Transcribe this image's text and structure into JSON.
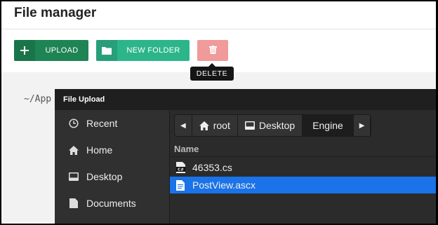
{
  "page": {
    "title": "File manager"
  },
  "toolbar": {
    "upload_label": "UPLOAD",
    "new_folder_label": "NEW FOLDER",
    "delete_tooltip": "DELETE"
  },
  "path": {
    "text": "~/App"
  },
  "dialog": {
    "title": "File Upload",
    "sidebar": [
      {
        "label": "Recent",
        "icon": "clock-icon"
      },
      {
        "label": "Home",
        "icon": "home-icon"
      },
      {
        "label": "Desktop",
        "icon": "desktop-icon"
      },
      {
        "label": "Documents",
        "icon": "document-icon"
      }
    ],
    "breadcrumbs": [
      {
        "label": "root",
        "icon": "home-icon"
      },
      {
        "label": "Desktop",
        "icon": "desktop-icon"
      },
      {
        "label": "Engine",
        "active": true
      }
    ],
    "columns": {
      "name": "Name"
    },
    "files": [
      {
        "name": "46353.cs",
        "icon": "csharp-file-icon",
        "selected": false
      },
      {
        "name": "PostView.ascx",
        "icon": "text-file-icon",
        "selected": true
      }
    ]
  },
  "colors": {
    "upload": "#1e8454",
    "new_folder": "#2db58a",
    "delete": "#f09a9a",
    "selection": "#1a73e8"
  }
}
